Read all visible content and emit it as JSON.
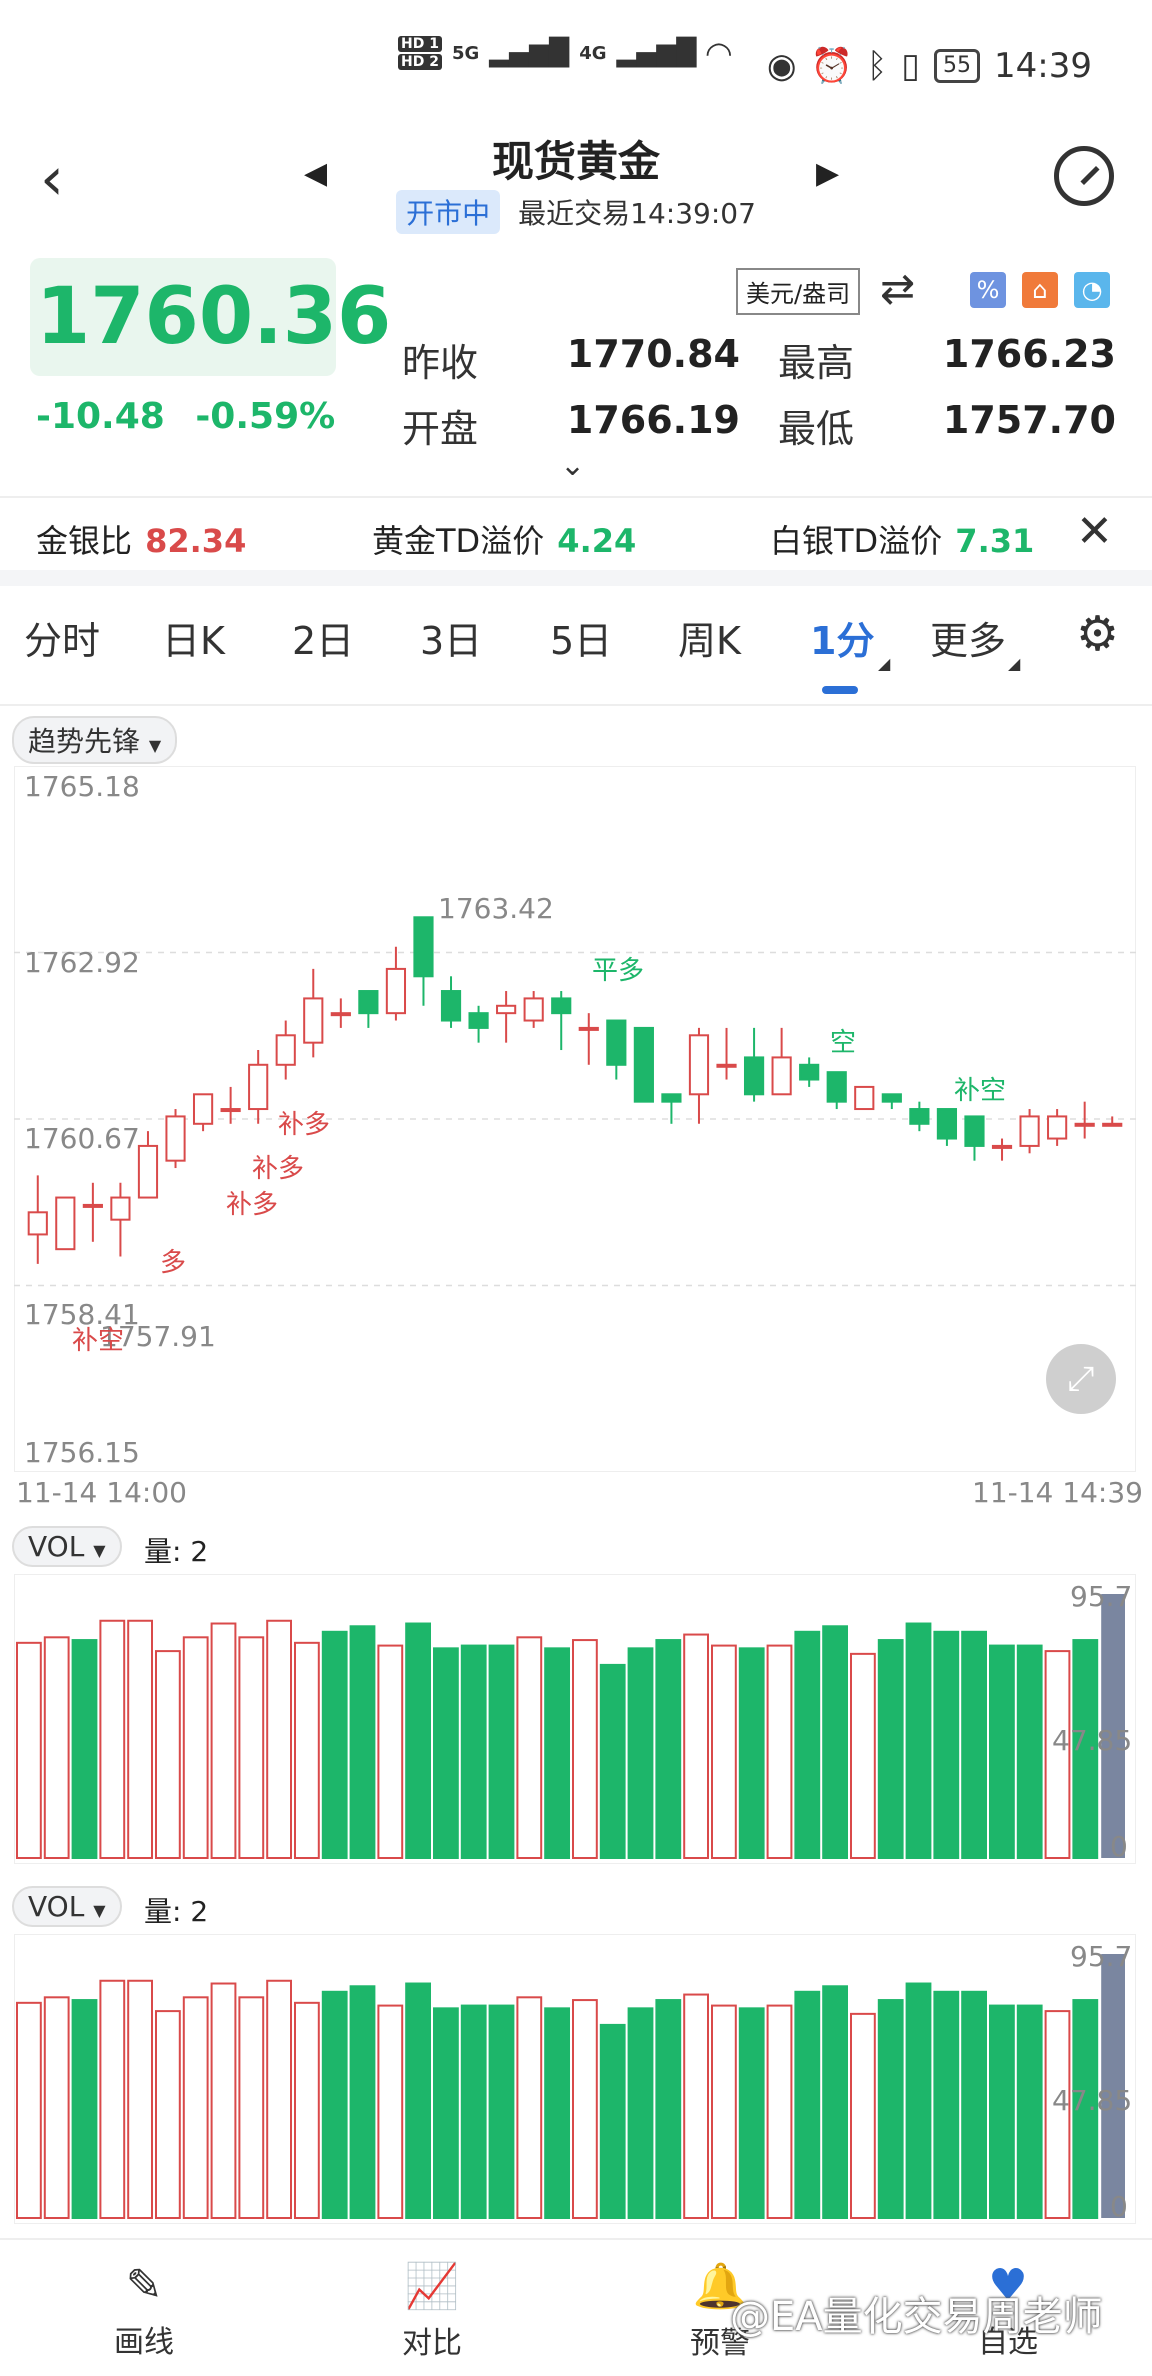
{
  "status_bar": {
    "network_left": [
      "HD 1",
      "HD 2",
      "5G",
      "4G"
    ],
    "battery": "55",
    "time": "14:39"
  },
  "header": {
    "title": "现货黄金",
    "market_state": "开市中",
    "last_trade": "最近交易14:39:07"
  },
  "quote": {
    "price": "1760.36",
    "change": "-10.48",
    "change_pct": "-0.59%",
    "unit": "美元/盎司",
    "prev_close_label": "昨收",
    "prev_close": "1770.84",
    "high_label": "最高",
    "high": "1766.23",
    "open_label": "开盘",
    "open": "1766.19",
    "low_label": "最低",
    "low": "1757.70"
  },
  "ratios": {
    "gold_silver_label": "金银比",
    "gold_silver": "82.34",
    "gold_td_label": "黄金TD溢价",
    "gold_td": "4.24",
    "silver_td_label": "白银TD溢价",
    "silver_td": "7.31"
  },
  "tabs": [
    "分时",
    "日K",
    "2日",
    "3日",
    "5日",
    "周K",
    "1分",
    "更多"
  ],
  "active_tab": "1分",
  "indicator": "趋势先锋",
  "chart_labels": {
    "y_top": "1765.18",
    "y_mid1": "1762.92",
    "y_mid2": "1760.67",
    "y_mid3": "1758.41",
    "y_bottom": "1756.15",
    "high_mark": "1763.42",
    "low_mark": "1757.91",
    "x_start": "11-14 14:00",
    "x_end": "11-14 14:39"
  },
  "signals": [
    {
      "text": "补空",
      "color": "#d94a4a"
    },
    {
      "text": "多",
      "color": "#d94a4a"
    },
    {
      "text": "补多",
      "color": "#d94a4a"
    },
    {
      "text": "补多",
      "color": "#d94a4a"
    },
    {
      "text": "补多",
      "color": "#d94a4a"
    },
    {
      "text": "平多",
      "color": "#1db66a"
    },
    {
      "text": "空",
      "color": "#1db66a"
    },
    {
      "text": "补空",
      "color": "#1db66a"
    }
  ],
  "vol_panels": [
    {
      "indicator": "VOL",
      "label": "量: 2",
      "max": "95.7",
      "mid": "47.85",
      "min": "0"
    },
    {
      "indicator": "VOL",
      "label": "量: 2",
      "max": "95.7",
      "mid": "47.85",
      "min": "0"
    }
  ],
  "chart_data": {
    "type": "candlestick",
    "ylim": [
      1756.15,
      1765.18
    ],
    "candles": [
      {
        "o": 1759.1,
        "c": 1759.4,
        "h": 1759.9,
        "l": 1758.7
      },
      {
        "o": 1758.9,
        "c": 1759.6,
        "h": 1759.6,
        "l": 1758.9
      },
      {
        "o": 1759.5,
        "c": 1759.5,
        "h": 1759.8,
        "l": 1759.0
      },
      {
        "o": 1759.3,
        "c": 1759.6,
        "h": 1759.8,
        "l": 1758.8
      },
      {
        "o": 1759.6,
        "c": 1760.3,
        "h": 1760.5,
        "l": 1759.6
      },
      {
        "o": 1760.1,
        "c": 1760.7,
        "h": 1760.8,
        "l": 1760.0
      },
      {
        "o": 1760.6,
        "c": 1761.0,
        "h": 1761.0,
        "l": 1760.5
      },
      {
        "o": 1760.8,
        "c": 1760.8,
        "h": 1761.1,
        "l": 1760.6
      },
      {
        "o": 1760.8,
        "c": 1761.4,
        "h": 1761.6,
        "l": 1760.6
      },
      {
        "o": 1761.4,
        "c": 1761.8,
        "h": 1762.0,
        "l": 1761.2
      },
      {
        "o": 1761.7,
        "c": 1762.3,
        "h": 1762.7,
        "l": 1761.5
      },
      {
        "o": 1762.1,
        "c": 1762.1,
        "h": 1762.3,
        "l": 1761.9
      },
      {
        "o": 1762.4,
        "c": 1762.1,
        "h": 1762.4,
        "l": 1761.9
      },
      {
        "o": 1762.1,
        "c": 1762.7,
        "h": 1763.0,
        "l": 1762.0
      },
      {
        "o": 1763.4,
        "c": 1762.6,
        "h": 1763.4,
        "l": 1762.2
      },
      {
        "o": 1762.4,
        "c": 1762.0,
        "h": 1762.6,
        "l": 1761.9
      },
      {
        "o": 1762.1,
        "c": 1761.9,
        "h": 1762.2,
        "l": 1761.7
      },
      {
        "o": 1762.1,
        "c": 1762.2,
        "h": 1762.4,
        "l": 1761.7
      },
      {
        "o": 1762.0,
        "c": 1762.3,
        "h": 1762.4,
        "l": 1761.9
      },
      {
        "o": 1762.3,
        "c": 1762.1,
        "h": 1762.4,
        "l": 1761.6
      },
      {
        "o": 1761.9,
        "c": 1761.9,
        "h": 1762.1,
        "l": 1761.4
      },
      {
        "o": 1762.0,
        "c": 1761.4,
        "h": 1762.0,
        "l": 1761.2
      },
      {
        "o": 1761.9,
        "c": 1760.9,
        "h": 1761.9,
        "l": 1760.9
      },
      {
        "o": 1761.0,
        "c": 1760.9,
        "h": 1761.0,
        "l": 1760.6
      },
      {
        "o": 1761.0,
        "c": 1761.8,
        "h": 1761.9,
        "l": 1760.6
      },
      {
        "o": 1761.4,
        "c": 1761.4,
        "h": 1761.9,
        "l": 1761.2
      },
      {
        "o": 1761.5,
        "c": 1761.0,
        "h": 1761.9,
        "l": 1760.9
      },
      {
        "o": 1761.0,
        "c": 1761.5,
        "h": 1761.9,
        "l": 1761.0
      },
      {
        "o": 1761.4,
        "c": 1761.2,
        "h": 1761.5,
        "l": 1761.1
      },
      {
        "o": 1761.3,
        "c": 1760.9,
        "h": 1761.3,
        "l": 1760.8
      },
      {
        "o": 1760.8,
        "c": 1761.1,
        "h": 1761.1,
        "l": 1760.8
      },
      {
        "o": 1761.0,
        "c": 1760.9,
        "h": 1761.0,
        "l": 1760.8
      },
      {
        "o": 1760.8,
        "c": 1760.6,
        "h": 1760.9,
        "l": 1760.5
      },
      {
        "o": 1760.8,
        "c": 1760.4,
        "h": 1760.8,
        "l": 1760.3
      },
      {
        "o": 1760.7,
        "c": 1760.3,
        "h": 1760.7,
        "l": 1760.1
      },
      {
        "o": 1760.3,
        "c": 1760.3,
        "h": 1760.4,
        "l": 1760.1
      },
      {
        "o": 1760.3,
        "c": 1760.7,
        "h": 1760.8,
        "l": 1760.2
      },
      {
        "o": 1760.4,
        "c": 1760.7,
        "h": 1760.8,
        "l": 1760.3
      },
      {
        "o": 1760.6,
        "c": 1760.6,
        "h": 1760.9,
        "l": 1760.4
      },
      {
        "o": 1760.6,
        "c": 1760.6,
        "h": 1760.7,
        "l": 1760.6
      }
    ],
    "volume_max": 95.7,
    "volumes": [
      {
        "v": 78,
        "up": true
      },
      {
        "v": 80,
        "up": true
      },
      {
        "v": 79,
        "up": false
      },
      {
        "v": 86,
        "up": true
      },
      {
        "v": 86,
        "up": true
      },
      {
        "v": 75,
        "up": true
      },
      {
        "v": 80,
        "up": true
      },
      {
        "v": 85,
        "up": true
      },
      {
        "v": 80,
        "up": true
      },
      {
        "v": 86,
        "up": true
      },
      {
        "v": 78,
        "up": true
      },
      {
        "v": 82,
        "up": false
      },
      {
        "v": 84,
        "up": false
      },
      {
        "v": 77,
        "up": true
      },
      {
        "v": 85,
        "up": false
      },
      {
        "v": 76,
        "up": false
      },
      {
        "v": 77,
        "up": false
      },
      {
        "v": 77,
        "up": false
      },
      {
        "v": 80,
        "up": true
      },
      {
        "v": 76,
        "up": false
      },
      {
        "v": 79,
        "up": true
      },
      {
        "v": 70,
        "up": false
      },
      {
        "v": 76,
        "up": false
      },
      {
        "v": 79,
        "up": false
      },
      {
        "v": 81,
        "up": true
      },
      {
        "v": 77,
        "up": true
      },
      {
        "v": 76,
        "up": false
      },
      {
        "v": 77,
        "up": true
      },
      {
        "v": 82,
        "up": false
      },
      {
        "v": 84,
        "up": false
      },
      {
        "v": 74,
        "up": true
      },
      {
        "v": 79,
        "up": false
      },
      {
        "v": 85,
        "up": false
      },
      {
        "v": 82,
        "up": false
      },
      {
        "v": 82,
        "up": false
      },
      {
        "v": 77,
        "up": false
      },
      {
        "v": 77,
        "up": false
      },
      {
        "v": 75,
        "up": true
      },
      {
        "v": 79,
        "up": false
      }
    ]
  },
  "bottom_nav": [
    {
      "label": "画线",
      "icon": "pen-icon"
    },
    {
      "label": "对比",
      "icon": "compare-chart-icon"
    },
    {
      "label": "预警",
      "icon": "alarm-icon"
    },
    {
      "label": "自选",
      "icon": "heart-icon"
    }
  ],
  "watermark": "@EA量化交易周老师"
}
